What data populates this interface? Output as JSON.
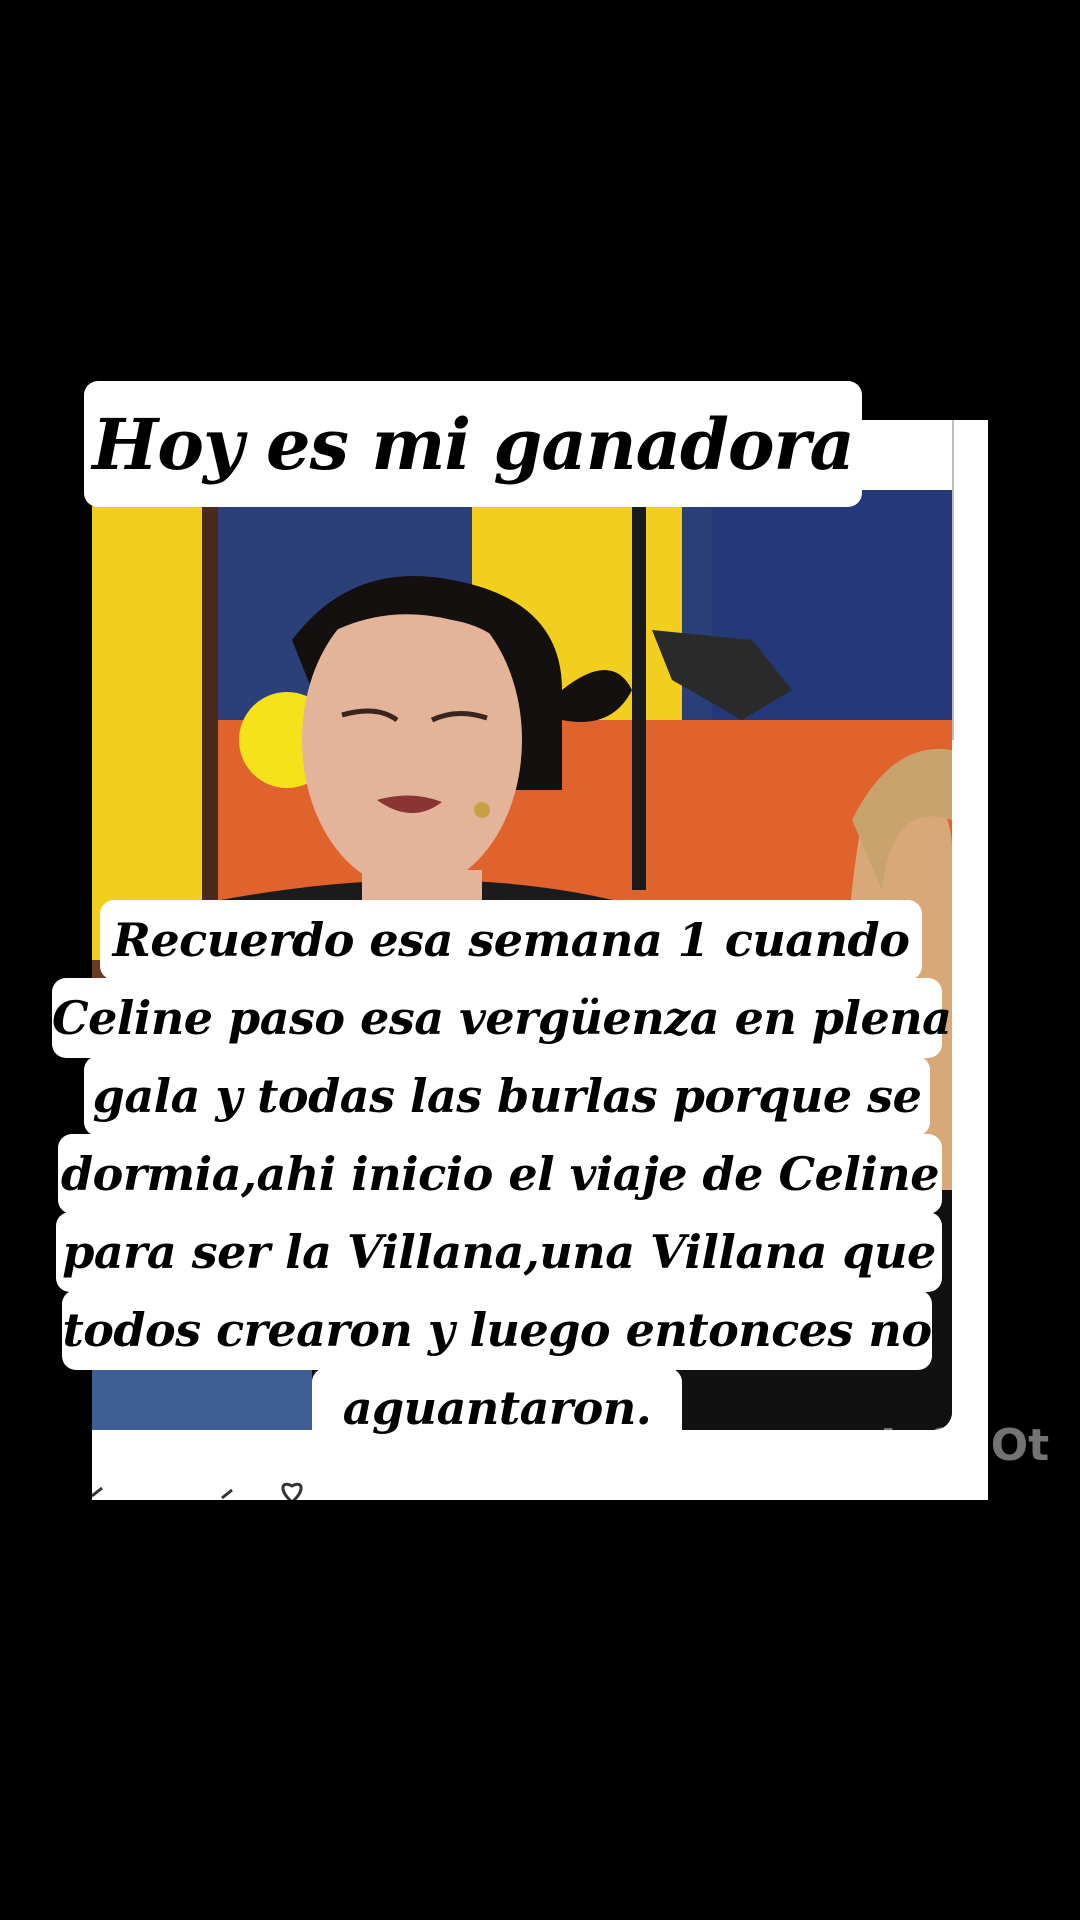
{
  "title": "Hoy es mi ganadora",
  "caption_lines": [
    "Recuerdo esa semana 1 cuando",
    "Celine paso esa vergüenza en plena",
    "gala y todas las burlas porque se",
    "dormia,ahi inicio el viaje de Celine",
    "para ser la Villana,una Villana que",
    "todos crearon y luego entonces no",
    "aguantaron."
  ],
  "watermark": "InShOt",
  "colors": {
    "background": "#000000",
    "label_bg": "#ffffff",
    "text": "#000000",
    "frame_yellow": "#f2cf1f",
    "frame_orange": "#e0622d",
    "frame_blue": "#2b3f78"
  },
  "icons": [
    "heart-icon"
  ]
}
